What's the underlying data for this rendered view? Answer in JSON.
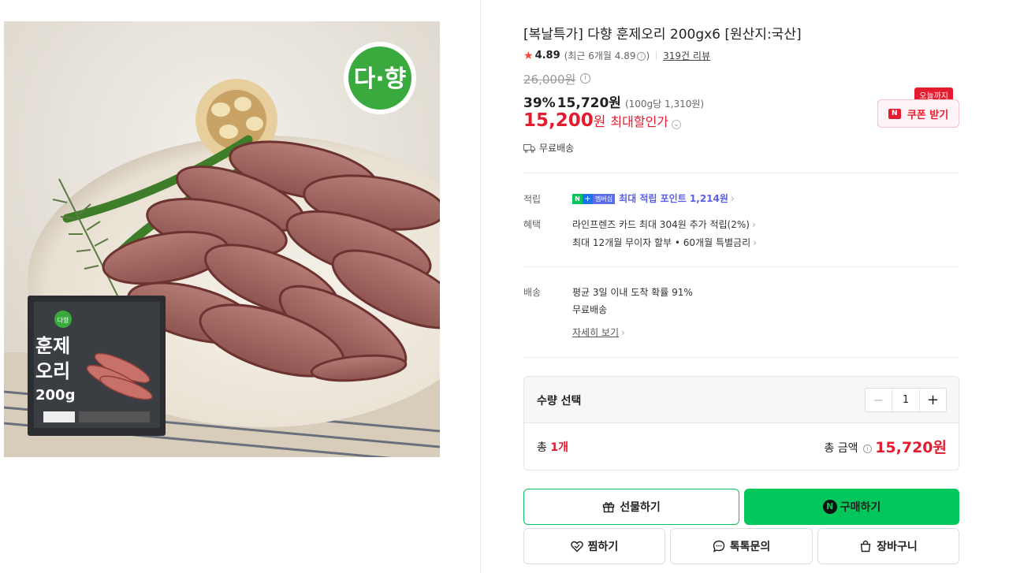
{
  "product": {
    "title": "[복날특가] 다향 훈제오리 200gx6 [원산지:국산]",
    "image_alt": "다향 훈제오리 제품 이미지"
  },
  "image": {
    "brand_logo": "다·향",
    "package_title_1": "훈제",
    "package_title_2": "오리",
    "package_weight": "200g",
    "package_brand": "다향"
  },
  "rating": {
    "star_icon": "star-icon",
    "score": "4.89",
    "recent": "(최근 6개월 4.89",
    "recent_close": ")",
    "reviews": "319건 리뷰"
  },
  "price": {
    "original": "26,000원",
    "discount_rate": "39%",
    "sale": "15,720원",
    "unit_price": "(100g당 1,310원)",
    "max_discount": "15,200",
    "max_discount_unit": "원",
    "max_label": "최대할인가",
    "shipping": "무료배송"
  },
  "coupon": {
    "today_badge": "오늘까지",
    "mark": "N",
    "label": "쿠폰 받기"
  },
  "benefits": {
    "points_label": "적립",
    "points_badge_n": "N",
    "points_badge_plus": "+",
    "points_badge_member": "멤버십",
    "points_text": "최대 적립 포인트 1,214원",
    "perks_label": "혜택",
    "perk_1": "라인프렌즈 카드 최대 304원 추가 적립(2%)",
    "perk_2": "최대 12개월 무이자 할부 • 60개월 특별금리"
  },
  "delivery": {
    "label": "배송",
    "eta": "평균 3일 이내 도착 확률 91%",
    "fee": "무료배송",
    "details": "자세히 보기"
  },
  "quantity": {
    "label": "수량 선택",
    "minus": "−",
    "value": "1",
    "plus": "+",
    "total_prefix": "총 ",
    "total_count": "1개",
    "total_label": "총 금액",
    "total_price": "15,720원"
  },
  "actions": {
    "gift": "선물하기",
    "buy_mark": "N",
    "buy": "구매하기",
    "wish": "찜하기",
    "talk": "톡톡문의",
    "cart": "장바구니"
  },
  "colors": {
    "accent_red": "#e41c30",
    "naver_green": "#03c75a",
    "point_purple": "#5b5ee8"
  }
}
